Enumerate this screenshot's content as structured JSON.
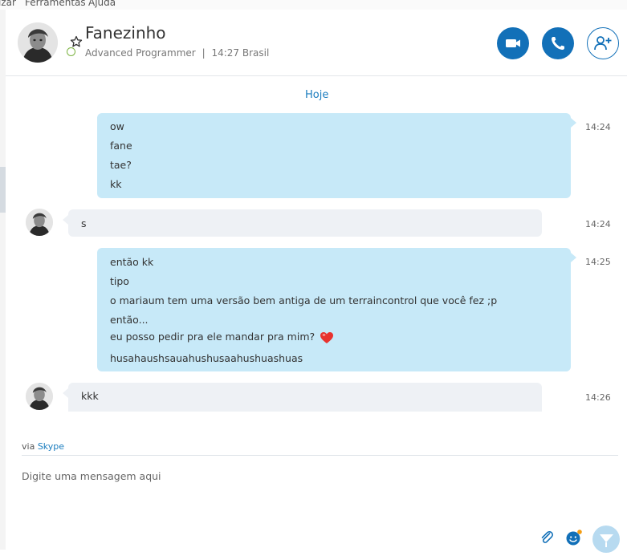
{
  "menu": {
    "items": [
      "izar",
      "Ferramentas",
      "Ajuda"
    ]
  },
  "contact": {
    "name": "Fanezinho",
    "mood": "Advanced Programmer",
    "separator": "|",
    "local_time": "14:27 Brasil",
    "status_color": "#7cb342"
  },
  "header_actions": [
    {
      "name": "video-call-button",
      "icon": "video-camera-icon"
    },
    {
      "name": "audio-call-button",
      "icon": "phone-icon"
    },
    {
      "name": "add-people-button",
      "icon": "add-person-icon"
    }
  ],
  "conversation": {
    "date_separator": "Hoje",
    "messages": [
      {
        "direction": "outgoing",
        "time": "14:24",
        "lines": [
          "ow",
          "fane",
          "tae?",
          "kk"
        ]
      },
      {
        "direction": "incoming",
        "time": "14:24",
        "lines": [
          "s"
        ]
      },
      {
        "direction": "outgoing",
        "time": "14:25",
        "lines": [
          "então kk",
          "tipo",
          "o mariaum tem uma versão bem antiga de um terraincontrol que você fez ;p",
          "então...",
          "eu posso pedir pra ele mandar pra mim?",
          "husahaushsauahushusaahushuashuas"
        ]
      },
      {
        "direction": "incoming",
        "time": "14:26",
        "lines": [
          "kkk"
        ]
      }
    ]
  },
  "footer": {
    "via_prefix": "via",
    "via_link": "Skype",
    "compose_placeholder": "Digite uma mensagem aqui"
  },
  "colors": {
    "accent": "#1270b8",
    "outgoing_bubble": "#c7e9f8",
    "incoming_bubble": "#eef1f5",
    "link": "#1b7dbf"
  }
}
